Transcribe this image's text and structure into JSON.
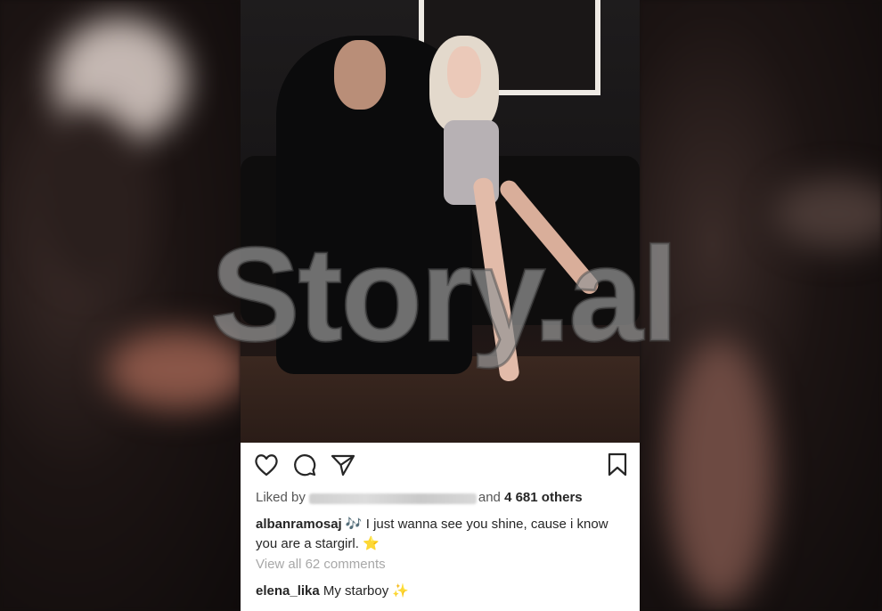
{
  "watermark": "Story.al",
  "post": {
    "liked_by_prefix": "Liked by",
    "liked_by_suffix": "and",
    "likes_count": "4 681 others",
    "caption_user": "albanramosaj",
    "caption_emoji": "🎶",
    "caption_text_1": "I just wanna see you shine, cause i know",
    "caption_text_2": "you are a stargirl.",
    "caption_star": "⭐",
    "view_comments": "View all 62 comments",
    "comment_user": "elena_lika",
    "comment_text": "My starboy",
    "comment_sparkle": "✨"
  },
  "icons": {
    "like": "heart-icon",
    "comment": "comment-icon",
    "share": "send-icon",
    "save": "bookmark-icon"
  }
}
